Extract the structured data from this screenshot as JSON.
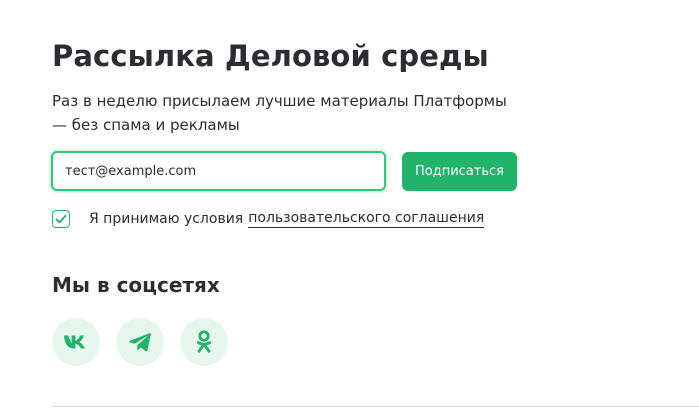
{
  "newsletter": {
    "title": "Рассылка Деловой среды",
    "description": "Раз в неделю присылаем лучшие материалы Платформы — без спама и рекламы",
    "email_value": "тест@example.com",
    "subscribe_label": "Подписаться",
    "agree_text": "Я принимаю условия",
    "agree_link": "пользовательского соглашения",
    "agree_checked": true
  },
  "social": {
    "heading": "Мы в соцсетях",
    "items": [
      {
        "icon": "vk-icon"
      },
      {
        "icon": "telegram-icon"
      },
      {
        "icon": "odnoklassniki-icon"
      }
    ]
  },
  "colors": {
    "accent": "#21b36a",
    "focus_border": "#2ecb74",
    "social_bg": "#e8f7ee",
    "text": "#2b2d33"
  }
}
